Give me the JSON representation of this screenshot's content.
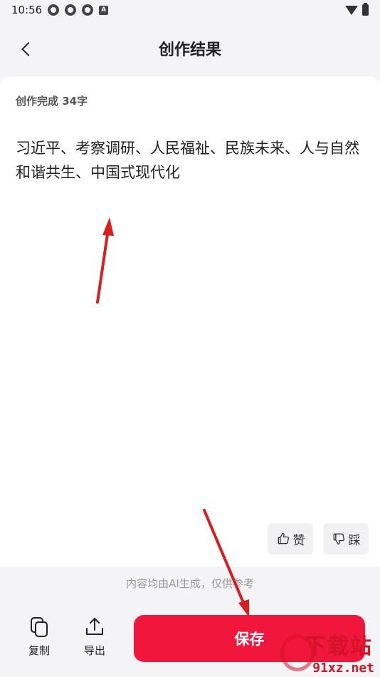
{
  "status_bar": {
    "time": "10:56",
    "notification_icons": [
      "pinwheel-icon",
      "pinwheel-icon",
      "pinwheel-icon",
      "a-badge-icon"
    ],
    "a_badge": "A"
  },
  "nav": {
    "title": "创作结果"
  },
  "card": {
    "meta": "创作完成 34字",
    "content": "习近平、考察调研、人民福祉、民族未来、人与自然和谐共生、中国式现代化",
    "like_label": "赞",
    "dislike_label": "踩"
  },
  "ai_note": "内容均由AI生成，仅供参考",
  "bottom_bar": {
    "copy_label": "复制",
    "export_label": "导出",
    "save_label": "保存"
  },
  "watermark": {
    "brand": "下载站",
    "domain": "91xz.net"
  },
  "colors": {
    "accent": "#f0163c",
    "background": "#f4f4f6",
    "card": "#ffffff",
    "annotation_arrow": "#d81e1e"
  }
}
